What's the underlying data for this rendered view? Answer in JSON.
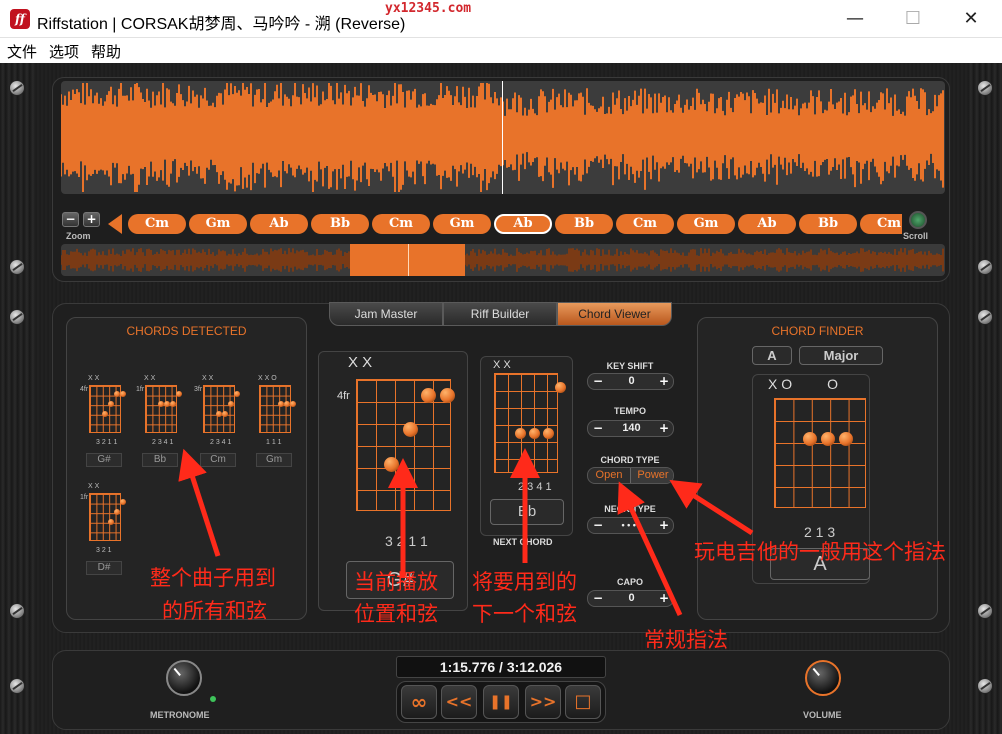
{
  "window": {
    "title": "Riffstation | CORSAK胡梦周、马吟吟 - 溯 (Reverse)",
    "watermark": "yx12345.com",
    "icon_label": "ff",
    "minimize": "—",
    "maximize": "☐",
    "close": "✕"
  },
  "menu": {
    "items": [
      "文件",
      "选项",
      "帮助"
    ]
  },
  "waveform": {
    "zoom_minus": "−",
    "zoom_plus": "+",
    "zoom_label": "Zoom",
    "scroll_label": "Scroll",
    "chords": [
      "Cm",
      "Gm",
      "Ab",
      "Bb",
      "Cm",
      "Gm",
      "Ab",
      "Bb",
      "Cm",
      "Gm",
      "Ab",
      "Bb",
      "Cm"
    ],
    "active_index": 6,
    "playhead_position": 0.5
  },
  "tabs": [
    "Jam Master",
    "Riff Builder",
    "Chord Viewer"
  ],
  "active_tab": "Chord Viewer",
  "chords_detected": {
    "title": "CHORDS DETECTED",
    "chords": [
      {
        "name": "G#",
        "fret": "4fr",
        "top": "X X",
        "fingers": "3 2 1 1"
      },
      {
        "name": "Bb",
        "fret": "1fr",
        "top": "X X",
        "fingers": "2 3 4 1"
      },
      {
        "name": "Cm",
        "fret": "3fr",
        "top": "X X",
        "fingers": "2 3 4 1"
      },
      {
        "name": "Gm",
        "fret": "",
        "top": "X X O",
        "fingers": "1 1 1"
      },
      {
        "name": "D#",
        "fret": "1fr",
        "top": "X X",
        "fingers": "3 2 1"
      }
    ]
  },
  "current_chord": {
    "top": "X X",
    "fret": "4fr",
    "fingers": "3 2 1 1",
    "name": "G#"
  },
  "next_chord": {
    "top": "X X",
    "fingers": "2 3 4 1",
    "name": "Bb",
    "label": "NEXT CHORD"
  },
  "controls": {
    "key_shift": {
      "label": "KEY SHIFT",
      "value": "0"
    },
    "tempo": {
      "label": "TEMPO",
      "value": "140"
    },
    "chord_type": {
      "label": "CHORD TYPE",
      "options": [
        "Open",
        "Power"
      ]
    },
    "neck_type": {
      "label": "NECK TYPE",
      "value": "• • • •"
    },
    "capo": {
      "label": "CAPO",
      "value": "0"
    },
    "minus": "−",
    "plus": "+"
  },
  "chord_finder": {
    "title": "CHORD FINDER",
    "root": "A",
    "quality": "Major",
    "top": "X O         O",
    "fingers": "2 1 3",
    "name": "A"
  },
  "transport": {
    "time": "1:15.776 / 3:12.026",
    "loop": "∞",
    "rewind": "<<",
    "pause": "❚❚",
    "forward": ">>",
    "stop": "□",
    "metronome": "METRONOME",
    "volume": "VOLUME"
  },
  "annotations": {
    "all_chords_1": "整个曲子用到",
    "all_chords_2": "的所有和弦",
    "current_1": "当前播放",
    "current_2": "位置和弦",
    "next_1": "将要用到的",
    "next_2": "下一个和弦",
    "electric": "玩电吉他的一般用这个指法",
    "normal": "常规指法"
  },
  "colors": {
    "accent": "#e8732a",
    "annotation": "#ff2a1a",
    "led": "#3ec35a"
  }
}
